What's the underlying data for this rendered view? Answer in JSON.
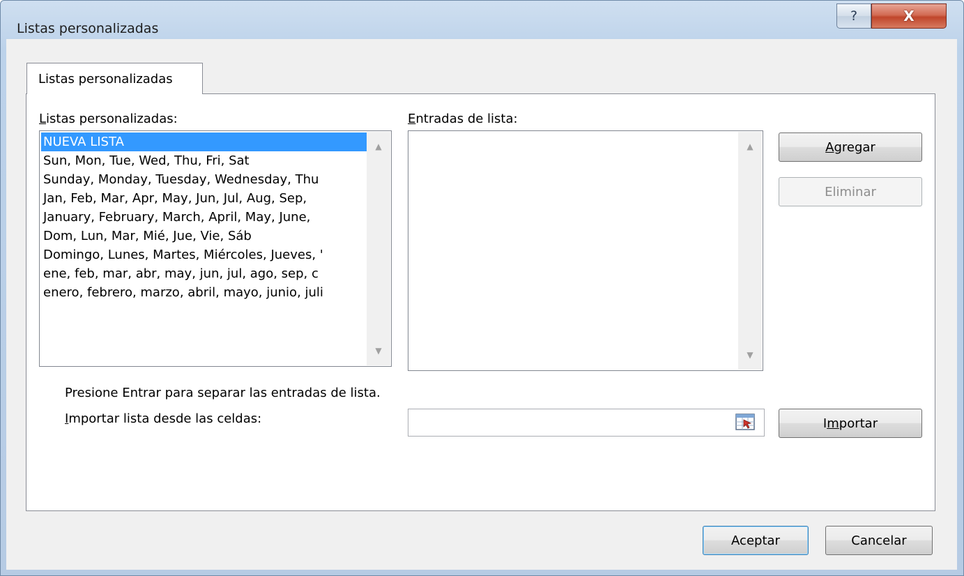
{
  "window": {
    "title": "Listas personalizadas",
    "help_glyph": "?",
    "close_glyph": "X"
  },
  "tab": {
    "label": "Listas personalizadas"
  },
  "lists": {
    "label_prefix": "L",
    "label_rest": "istas personalizadas:",
    "items": [
      "NUEVA LISTA",
      "Sun, Mon, Tue, Wed, Thu, Fri, Sat",
      "Sunday, Monday, Tuesday, Wednesday, Thu",
      "Jan, Feb, Mar, Apr, May, Jun, Jul, Aug, Sep,",
      "January, February, March, April, May, June,",
      "Dom, Lun, Mar, Mié, Jue, Vie, Sáb",
      "Domingo, Lunes, Martes, Miércoles, Jueves, '",
      "ene, feb, mar, abr, may, jun, jul, ago, sep, c",
      "enero, febrero, marzo, abril, mayo, junio, juli"
    ],
    "selected_index": 0
  },
  "entries": {
    "label_prefix": "E",
    "label_rest": "ntradas de lista:"
  },
  "buttons": {
    "add_prefix": "A",
    "add_rest": "gregar",
    "delete": "Eliminar",
    "import_pre": "I",
    "import_u": "m",
    "import_rest": "portar",
    "ok": "Aceptar",
    "cancel": "Cancelar"
  },
  "hint": "Presione Entrar para separar las entradas de lista.",
  "import_label_prefix": "I",
  "import_label_rest": "mportar lista desde las celdas:",
  "import_value": ""
}
